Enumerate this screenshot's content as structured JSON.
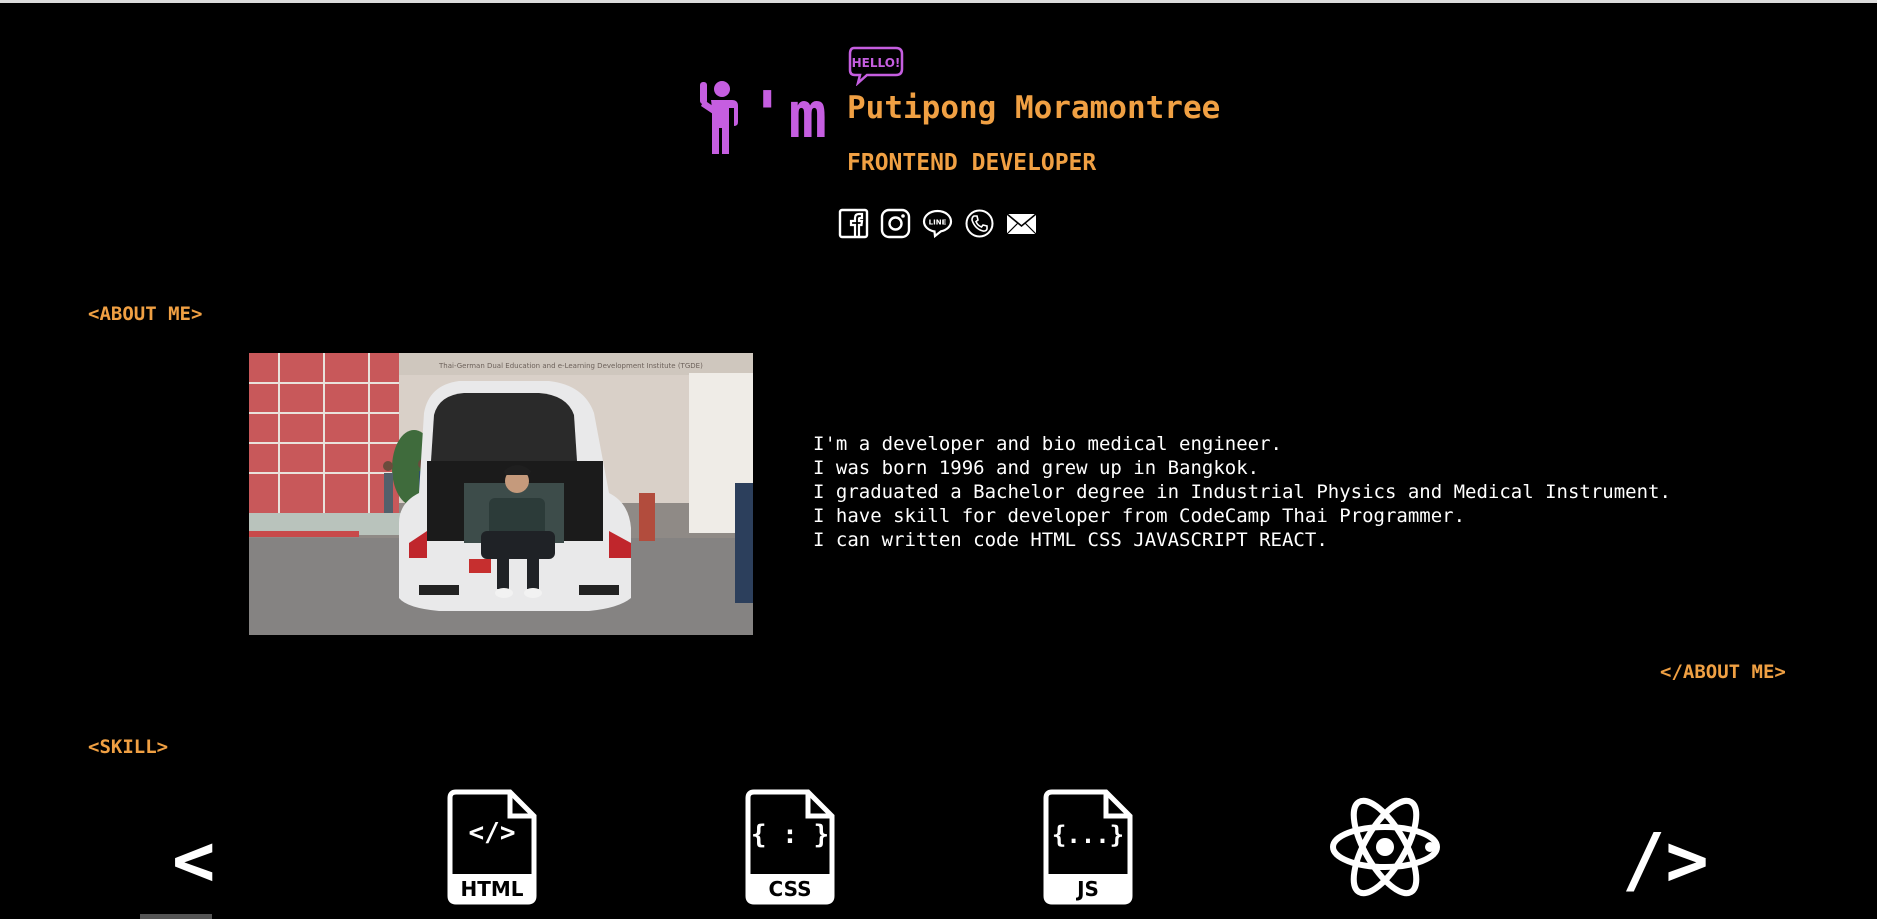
{
  "header": {
    "im_text": "'m",
    "hello_badge": "HELLO!",
    "name": "Putipong Moramontree",
    "role": "FRONTEND DEVELOPER",
    "wave_icon": "person-waving-icon",
    "socials": [
      {
        "name": "facebook-icon"
      },
      {
        "name": "instagram-icon"
      },
      {
        "name": "line-icon",
        "text": "LINE"
      },
      {
        "name": "phone-icon"
      },
      {
        "name": "mail-icon"
      }
    ]
  },
  "about": {
    "open_tag": "<ABOUT ME>",
    "close_tag": "</ABOUT ME>",
    "bio": [
      "I'm a developer and bio medical engineer.",
      "I was born 1996 and grew up in Bangkok.",
      "I graduated a Bachelor degree in Industrial Physics and Medical Instrument.",
      "I have skill for developer from CodeCamp Thai Programmer.",
      "I can written code HTML CSS JAVASCRIPT REACT."
    ],
    "photo_sign": "Thai-German Dual Education and e-Learning Development Institute (TGDE)"
  },
  "skill": {
    "open_tag": "<SKILL>",
    "left_chevron": "<",
    "right_chevron": "/>",
    "items": [
      {
        "name": "html-file-icon",
        "code": "</>",
        "label": "HTML"
      },
      {
        "name": "css-file-icon",
        "code": "{ : }",
        "label": "CSS"
      },
      {
        "name": "js-file-icon",
        "code": "{...}",
        "label": "JS"
      },
      {
        "name": "react-atom-icon"
      }
    ]
  },
  "colors": {
    "accent_orange": "#f0a043",
    "accent_purple": "#c55ee0",
    "background": "#000000",
    "text": "#ffffff"
  }
}
